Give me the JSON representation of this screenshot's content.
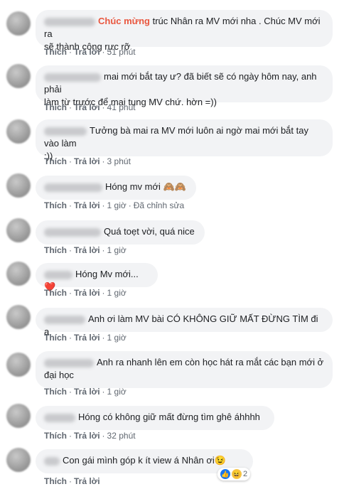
{
  "actions": {
    "like": "Thích",
    "reply": "Trả lời"
  },
  "comments": [
    {
      "lines": [
        "Chúc mừng trúc Nhân ra MV mới nha . Chúc MV mới ra",
        "sẽ thành công rực rỡ"
      ],
      "mention": "Chúc mừng",
      "mention_rest": " trúc Nhân ra MV mới nha . Chúc MV mới ra",
      "time": "51 phút"
    },
    {
      "lines": [
        "mai mới bắt tay ư? đã biết sẽ có ngày hôm nay, anh phải",
        "làm từ trước để mai tung MV chứ. hờn =))"
      ],
      "time": "41 phút"
    },
    {
      "lines": [
        "Tưởng bà mai ra MV mới luôn ai ngờ mai mới bắt tay vào làm",
        ":))"
      ],
      "time": "3 phút"
    },
    {
      "lines": [
        "Hóng mv mới 🙈🙈"
      ],
      "time": "1 giờ",
      "edited": "Đã chỉnh sửa"
    },
    {
      "lines": [
        "Quá toẹt vời, quá nice"
      ],
      "time": "1 giờ"
    },
    {
      "lines": [
        "Hóng Mv mới... ❤️"
      ],
      "time": "1 giờ"
    },
    {
      "lines": [
        "Anh ơi làm MV bài CÓ KHÔNG GIỮ MẤT ĐỪNG TÌM đi ạ"
      ],
      "time": "1 giờ"
    },
    {
      "lines": [
        "Anh ra nhanh lên em còn học hát ra mắt các bạn mới ở",
        "đại học"
      ],
      "time": "1 giờ"
    },
    {
      "lines": [
        "Hóng có không giữ mất đừng tìm ghê áhhhh"
      ],
      "time": "32 phút"
    },
    {
      "lines": [
        "Con gái mình góp k ít view á Nhân ơi😉"
      ],
      "reaction_count": "2"
    }
  ],
  "colors": {
    "mention": "#e9573f",
    "bubble": "#f2f3f5",
    "meta": "#606770",
    "like_blue": "#1877f2",
    "haha_yellow": "#f7c544"
  }
}
